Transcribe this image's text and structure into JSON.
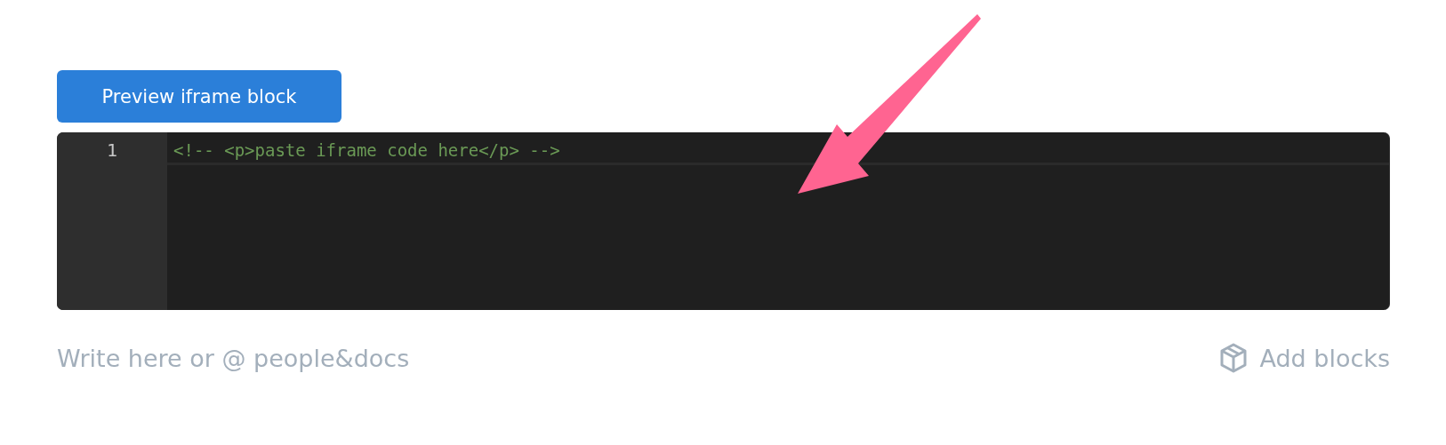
{
  "preview_button": {
    "label": "Preview iframe block"
  },
  "code_editor": {
    "lines": [
      {
        "number": "1",
        "text": "<!-- <p>paste iframe code here</p> -->",
        "kind": "comment"
      }
    ]
  },
  "editor_input": {
    "placeholder": "Write here or @ people&docs"
  },
  "add_blocks_button": {
    "label": "Add blocks"
  }
}
